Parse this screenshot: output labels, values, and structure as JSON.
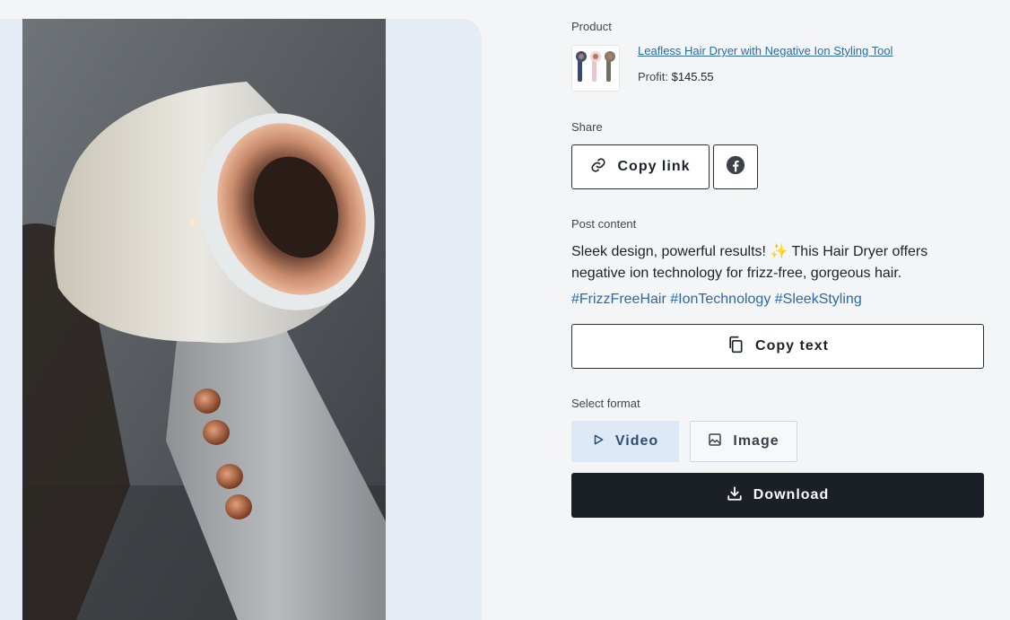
{
  "product": {
    "section_label": "Product",
    "title": "Leafless Hair Dryer with Negative Ion Styling Tool",
    "profit_label": "Profit:",
    "profit_value": "$145.55"
  },
  "share": {
    "section_label": "Share",
    "copy_link_label": "Copy link",
    "facebook_icon": "facebook-icon"
  },
  "post": {
    "section_label": "Post content",
    "text": "Sleek design, powerful results! ✨ This Hair Dryer offers negative ion technology for frizz-free, gorgeous hair.",
    "hashtags": "#FrizzFreeHair #IonTechnology #SleekStyling",
    "copy_text_label": "Copy text"
  },
  "format": {
    "section_label": "Select format",
    "options": [
      {
        "label": "Video",
        "icon": "play-icon",
        "selected": true
      },
      {
        "label": "Image",
        "icon": "image-icon",
        "selected": false
      }
    ]
  },
  "download": {
    "label": "Download",
    "icon": "download-icon"
  },
  "colors": {
    "accent_link": "#2b6aa6",
    "download_bg": "#1b2027",
    "selected_bg": "#dde9f7"
  }
}
